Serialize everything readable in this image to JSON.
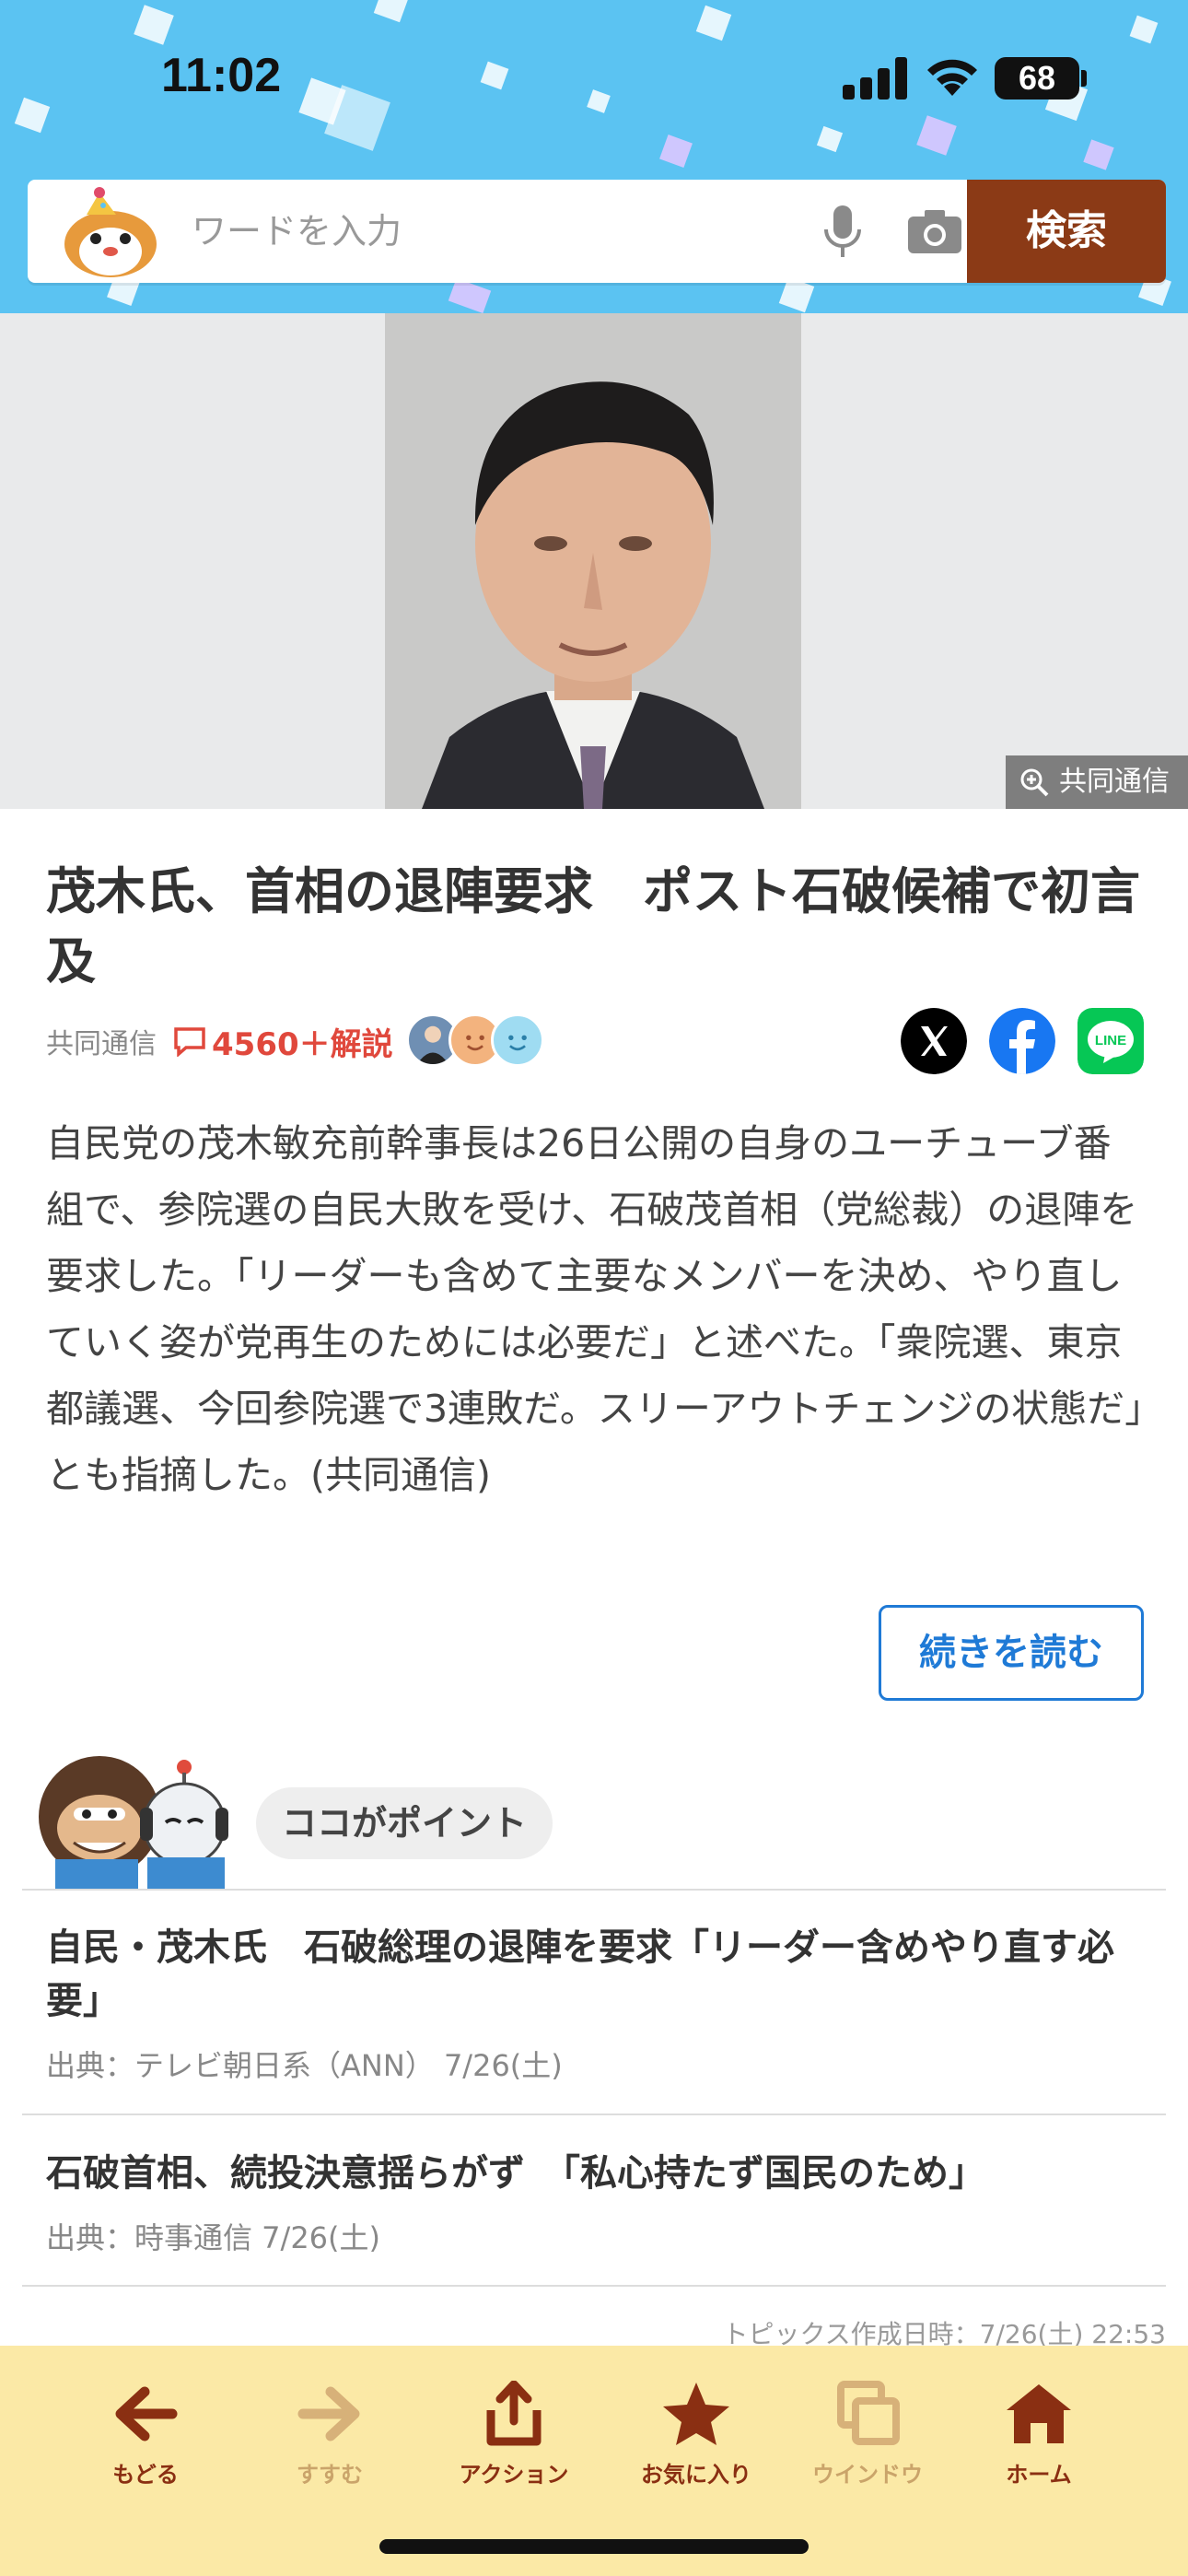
{
  "status_bar": {
    "time": "11:02",
    "battery": "68"
  },
  "search": {
    "placeholder": "ワードを入力",
    "button_label": "検索"
  },
  "hero": {
    "credit": "共同通信"
  },
  "article": {
    "title": "茂木氏、首相の退陣要求　ポスト石破候補で初言及",
    "source": "共同通信",
    "comment_count": "4560＋解説",
    "body": "自民党の茂木敏充前幹事長は26日公開の自身のユーチューブ番組で、参院選の自民大敗を受け、石破茂首相（党総裁）の退陣を要求した。「リーダーも含めて主要なメンバーを決め、やり直していく姿が党再生のためには必要だ」と述べた。「衆院選、東京都議選、今回参院選で3連敗だ。スリーアウトチェンジの状態だ」とも指摘した。(共同通信)",
    "read_more": "続きを読む"
  },
  "share": {
    "x": "x-icon",
    "facebook": "facebook-icon",
    "line_label": "LINE"
  },
  "points": {
    "label": "ココがポイント",
    "items": [
      {
        "title": "自民・茂木氏　石破総理の退陣を要求「リーダー含めやり直す必要」",
        "meta": "出典：テレビ朝日系（ANN） 7/26(土)"
      },
      {
        "title": "石破首相、続投決意揺らがず　「私心持たず国民のため」",
        "meta": "出典：時事通信 7/26(土)"
      }
    ],
    "created": "トピックス作成日時：7/26(土) 22:53"
  },
  "toolbar": {
    "items": [
      {
        "label": "もどる",
        "icon": "back-arrow-icon"
      },
      {
        "label": "すすむ",
        "icon": "forward-arrow-icon"
      },
      {
        "label": "アクション",
        "icon": "share-icon"
      },
      {
        "label": "お気に入り",
        "icon": "star-icon"
      },
      {
        "label": "ウインドウ",
        "icon": "windows-icon"
      },
      {
        "label": "ホーム",
        "icon": "home-icon"
      }
    ]
  },
  "colors": {
    "header": "#5bc3f2",
    "search_button": "#8b3a16",
    "toolbar": "#fbe9a6",
    "comment": "#e0483c",
    "link": "#1f7ad6"
  }
}
